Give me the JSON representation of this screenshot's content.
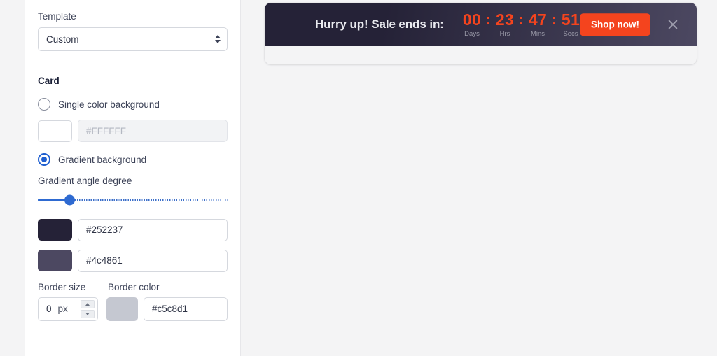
{
  "settings": {
    "template": {
      "label": "Template",
      "value": "Custom"
    },
    "card": {
      "title": "Card",
      "single_color_option": "Single color background",
      "single_color_placeholder": "#FFFFFF",
      "gradient_option": "Gradient background",
      "gradient_angle_label": "Gradient angle degree",
      "gradient_angle_percent": "17",
      "gradient_color_1": "#252237",
      "gradient_color_2": "#4c4861",
      "border_size_label": "Border size",
      "border_size_value": "0",
      "border_size_unit": "px",
      "border_color_label": "Border color",
      "border_color_value": "#c5c8d1"
    }
  },
  "preview": {
    "banner": {
      "headline": "Hurry up! Sale ends in:",
      "countdown": [
        {
          "value": "00",
          "label": "Days"
        },
        {
          "value": "23",
          "label": "Hrs"
        },
        {
          "value": "47",
          "label": "Mins"
        },
        {
          "value": "51",
          "label": "Secs"
        }
      ],
      "separator": ":",
      "cta_label": "Shop now!",
      "cta_color": "#f4441e",
      "gradient_from": "#252237",
      "gradient_to": "#4c4861",
      "close_icon": "close-icon"
    }
  }
}
